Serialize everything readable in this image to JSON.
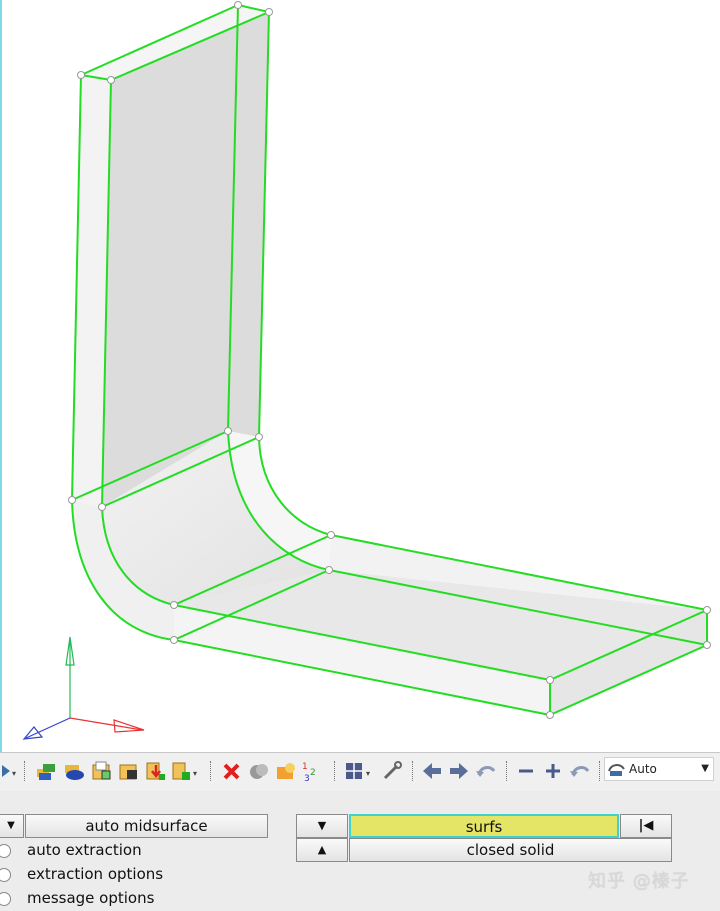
{
  "toolbar": {
    "display_mode": "Auto",
    "icons": [
      "select-icon",
      "component-color-icon",
      "component-shade-icon",
      "load-model-icon",
      "save-model-icon",
      "import-icon",
      "export-icon",
      "delete-icon",
      "mask-icon",
      "unmask-icon",
      "show-all-icon",
      "view-layout-icon",
      "tools-icon",
      "previous-view-icon",
      "next-view-icon",
      "undo-view-icon",
      "zoom-out-icon",
      "zoom-in-icon",
      "rotate-icon",
      "display-style-icon"
    ]
  },
  "panel": {
    "mode_selector": "auto midsurface",
    "entity_type": "surfs",
    "entity_subtype": "closed solid",
    "options": [
      "auto extraction",
      "extraction options",
      "message options"
    ]
  },
  "colors": {
    "edge": "#22dd22",
    "surface": "#eeeeee",
    "surface_shade": "#dcdcdc",
    "highlight": "#e4e466"
  },
  "watermark": "知乎 @榛子"
}
